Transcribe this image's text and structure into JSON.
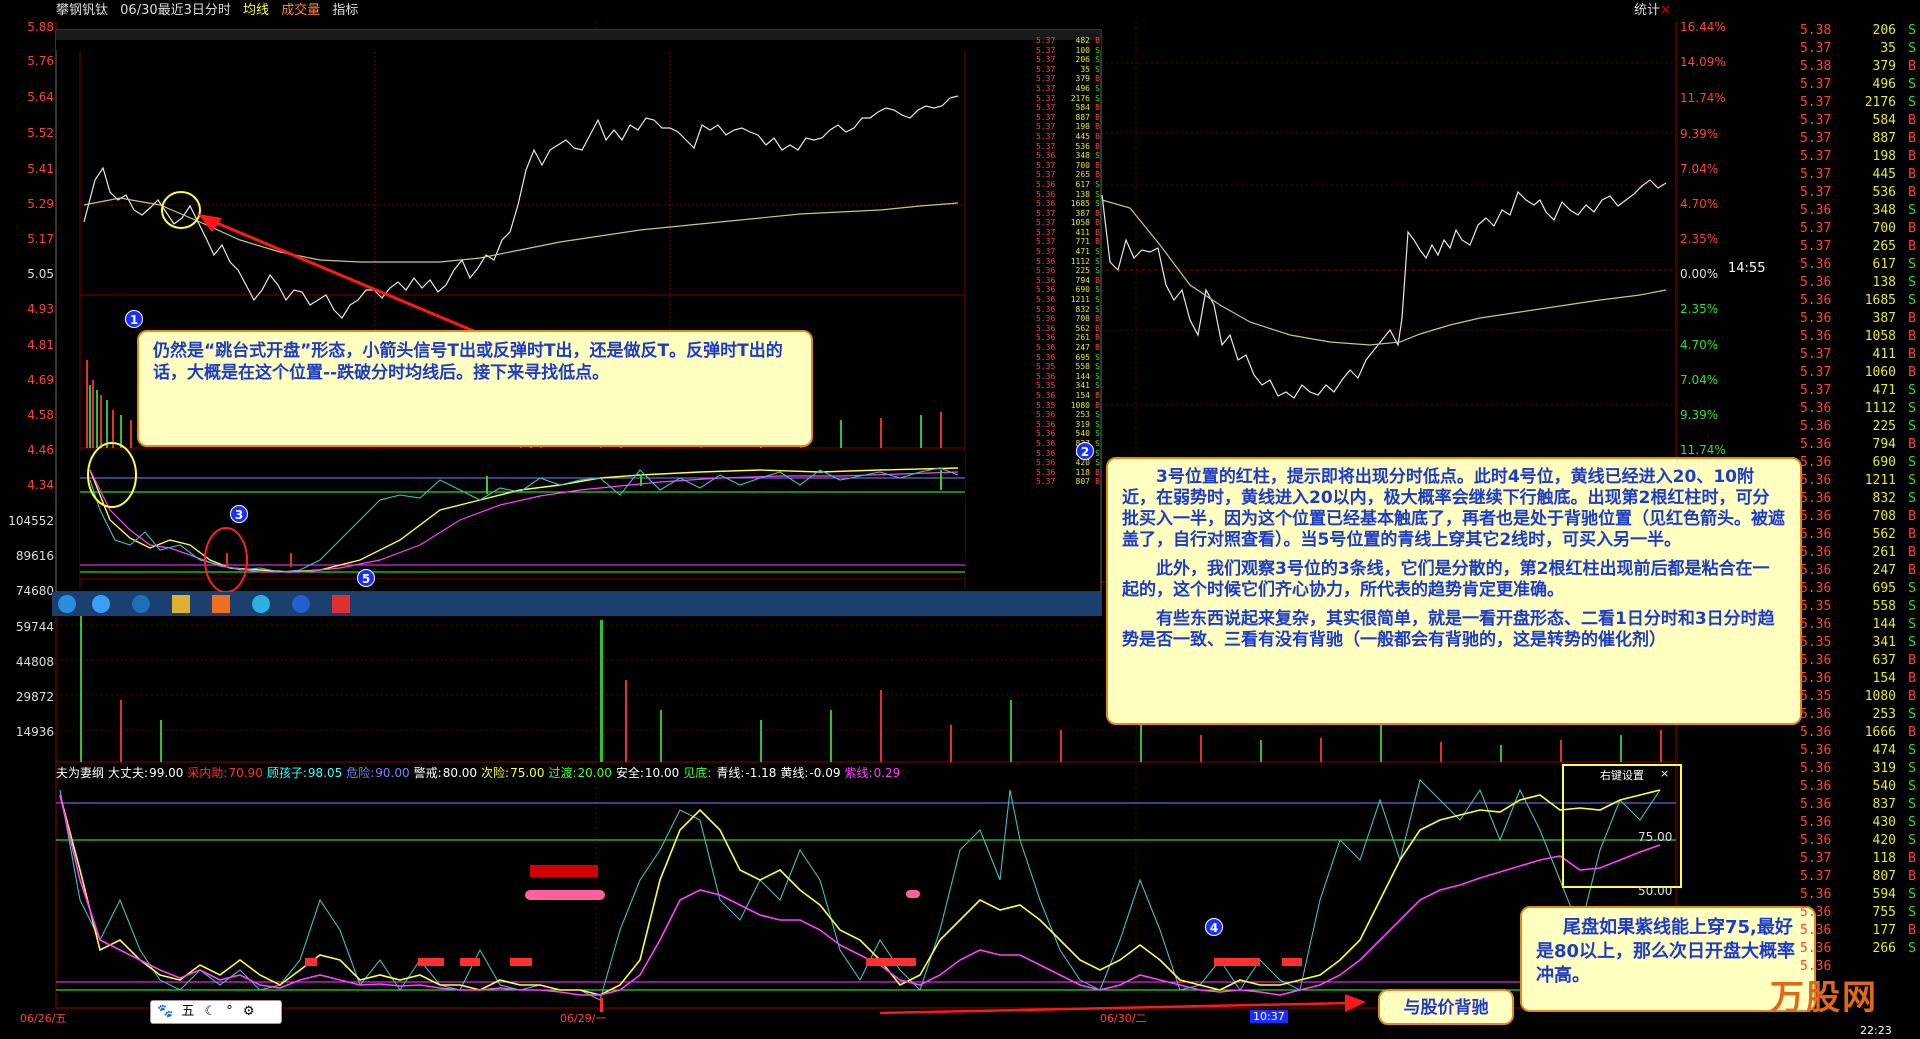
{
  "window": {
    "title_items": [
      "攀钢钒钛",
      "06/30最近3日分时",
      "均线",
      "成交量",
      "指标"
    ],
    "stats_label": "统计"
  },
  "left_axis": {
    "prices": [
      "5.88",
      "5.76",
      "5.64",
      "5.52",
      "5.41",
      "5.29",
      "5.17",
      "5.05",
      "4.93",
      "4.81",
      "4.69",
      "4.58",
      "4.46",
      "4.34"
    ],
    "volumes": [
      "104552",
      "89616",
      "74680",
      "59744",
      "44808",
      "29872",
      "14936"
    ]
  },
  "right_axis_pct_top": [
    "16.44%",
    "14.09%",
    "11.74%",
    "9.39%",
    "7.04%",
    "4.70%",
    "2.35%",
    "0.00%"
  ],
  "right_axis_pct_bottom": [
    "2.35%",
    "4.70%",
    "7.04%",
    "9.39%",
    "11.74%"
  ],
  "right_side_time": "14:55",
  "indicator_header": {
    "name": "夫为妻纲",
    "items": [
      {
        "label": "大丈夫:",
        "value": "99.00",
        "color": "#ffffff"
      },
      {
        "label": "采内助:",
        "value": "70.90",
        "color": "#ff3030"
      },
      {
        "label": "顾孩子:",
        "value": "98.05",
        "color": "#40ffff"
      },
      {
        "label": "危险:",
        "value": "90.00",
        "color": "#8080ff"
      },
      {
        "label": "警戒:",
        "value": "80.00",
        "color": "#ffffff"
      },
      {
        "label": "次险:",
        "value": "75.00",
        "color": "#ffff40"
      },
      {
        "label": "过渡:",
        "value": "20.00",
        "color": "#40ff40"
      },
      {
        "label": "安全:",
        "value": "10.00",
        "color": "#ffffff"
      },
      {
        "label": "见底:",
        "value": "",
        "color": "#40ff40"
      },
      {
        "label": "青线:",
        "value": "-1.18",
        "color": "#ffffff"
      },
      {
        "label": "黄线:",
        "value": "-0.09",
        "color": "#ffffff"
      },
      {
        "label": "紫线:",
        "value": "0.29",
        "color": "#ff40ff"
      }
    ]
  },
  "indicator_levels": {
    "upper": "75.00",
    "lower": "50.00"
  },
  "settings_box_label": "右键设置",
  "dates": {
    "d1": "06/26/五",
    "d2": "06/29/一",
    "d3": "06/30/二",
    "time": "10:37"
  },
  "notes": {
    "note1": "仍然是“跳台式开盘”形态，小箭头信号T出或反弹时T出，还是做反T。反弹时T出的话，大概是在这个位置--跌破分时均线后。接下来寻找低点。",
    "note2_p1": "3号位置的红柱，提示即将出现分时低点。此时4号位，黄线已经进入20、10附近，在弱势时，黄线进入20以内，极大概率会继续下行触底。出现第2根红柱时，可分批买入一半，因为这个位置已经基本触底了，再者也是处于背驰位置（见红色箭头。被遮盖了，自行对照查看）。当5号位置的青线上穿其它2线时，可买入另一半。",
    "note2_p2": "此外，我们观察3号位的3条线，它们是分散的，第2根红柱出现前后都是粘合在一起的，这个时候它们齐心协力，所代表的趋势肯定更准确。",
    "note2_p3": "有些东西说起来复杂，其实很简单，就是一看开盘形态、二看1日分时和3日分时趋势是否一致、三看有没有背驰（一般都会有背驰的，这是转势的催化剂）",
    "note3": "尾盘如果紫线能上穿75,最好是80以上，那么次日开盘大概率冲高。",
    "note4": "与股价背驰"
  },
  "markers": [
    "1",
    "2",
    "3",
    "4",
    "5"
  ],
  "toolbar_glyph": "五",
  "watermark": "万股网",
  "clock": "22:23",
  "ticker": [
    {
      "p": "5.38",
      "v": "206",
      "s": "S"
    },
    {
      "p": "5.37",
      "v": "35",
      "s": "S"
    },
    {
      "p": "5.38",
      "v": "379",
      "s": "B"
    },
    {
      "p": "5.37",
      "v": "496",
      "s": "S"
    },
    {
      "p": "5.37",
      "v": "2176",
      "s": "S"
    },
    {
      "p": "5.37",
      "v": "584",
      "s": "B"
    },
    {
      "p": "5.37",
      "v": "887",
      "s": "B"
    },
    {
      "p": "5.37",
      "v": "198",
      "s": "B"
    },
    {
      "p": "5.37",
      "v": "445",
      "s": "B"
    },
    {
      "p": "5.37",
      "v": "536",
      "s": "B"
    },
    {
      "p": "5.36",
      "v": "348",
      "s": "S"
    },
    {
      "p": "5.37",
      "v": "700",
      "s": "B"
    },
    {
      "p": "5.37",
      "v": "265",
      "s": "B"
    },
    {
      "p": "5.36",
      "v": "617",
      "s": "S"
    },
    {
      "p": "5.36",
      "v": "138",
      "s": "S"
    },
    {
      "p": "5.36",
      "v": "1685",
      "s": "S"
    },
    {
      "p": "5.36",
      "v": "387",
      "s": "B"
    },
    {
      "p": "5.36",
      "v": "1058",
      "s": "B"
    },
    {
      "p": "5.37",
      "v": "411",
      "s": "B"
    },
    {
      "p": "5.37",
      "v": "1060",
      "s": "B"
    },
    {
      "p": "5.37",
      "v": "471",
      "s": "S"
    },
    {
      "p": "5.36",
      "v": "1112",
      "s": "S"
    },
    {
      "p": "5.36",
      "v": "225",
      "s": "S"
    },
    {
      "p": "5.36",
      "v": "794",
      "s": "B"
    },
    {
      "p": "5.36",
      "v": "690",
      "s": "S"
    },
    {
      "p": "5.36",
      "v": "1211",
      "s": "S"
    },
    {
      "p": "5.36",
      "v": "832",
      "s": "S"
    },
    {
      "p": "5.36",
      "v": "708",
      "s": "B"
    },
    {
      "p": "5.36",
      "v": "562",
      "s": "B"
    },
    {
      "p": "5.36",
      "v": "261",
      "s": "B"
    },
    {
      "p": "5.36",
      "v": "247",
      "s": "B"
    },
    {
      "p": "5.36",
      "v": "695",
      "s": "S"
    },
    {
      "p": "5.35",
      "v": "558",
      "s": "S"
    },
    {
      "p": "5.36",
      "v": "144",
      "s": "S"
    },
    {
      "p": "5.35",
      "v": "341",
      "s": "S"
    },
    {
      "p": "5.36",
      "v": "637",
      "s": "B"
    },
    {
      "p": "5.36",
      "v": "154",
      "s": "B"
    },
    {
      "p": "5.35",
      "v": "1080",
      "s": "B"
    },
    {
      "p": "5.36",
      "v": "253",
      "s": "S"
    },
    {
      "p": "5.36",
      "v": "1666",
      "s": "B"
    },
    {
      "p": "5.36",
      "v": "474",
      "s": "S"
    },
    {
      "p": "5.36",
      "v": "319",
      "s": "S"
    },
    {
      "p": "5.36",
      "v": "540",
      "s": "S"
    },
    {
      "p": "5.36",
      "v": "837",
      "s": "S"
    },
    {
      "p": "5.36",
      "v": "430",
      "s": "S"
    },
    {
      "p": "5.36",
      "v": "420",
      "s": "S"
    },
    {
      "p": "5.37",
      "v": "118",
      "s": "B"
    },
    {
      "p": "5.37",
      "v": "807",
      "s": "B"
    },
    {
      "p": "5.36",
      "v": "594",
      "s": "S"
    },
    {
      "p": "5.36",
      "v": "755",
      "s": "S"
    },
    {
      "p": "5.36",
      "v": "177",
      "s": "B"
    },
    {
      "p": "5.36",
      "v": "266",
      "s": "S"
    },
    {
      "p": "5.36",
      "v": "",
      "s": ""
    }
  ],
  "inner_ticker": [
    {
      "p": "5.37",
      "v": "482",
      "s": "B"
    },
    {
      "p": "5.37",
      "v": "100",
      "s": "S"
    },
    {
      "p": "5.37",
      "v": "206",
      "s": "S"
    },
    {
      "p": "5.37",
      "v": "35",
      "s": "S"
    },
    {
      "p": "5.37",
      "v": "379",
      "s": "B"
    },
    {
      "p": "5.37",
      "v": "496",
      "s": "S"
    },
    {
      "p": "5.37",
      "v": "2176",
      "s": "S"
    },
    {
      "p": "5.37",
      "v": "584",
      "s": "B"
    },
    {
      "p": "5.37",
      "v": "887",
      "s": "B"
    },
    {
      "p": "5.37",
      "v": "198",
      "s": "B"
    },
    {
      "p": "5.37",
      "v": "445",
      "s": "B"
    },
    {
      "p": "5.37",
      "v": "536",
      "s": "B"
    },
    {
      "p": "5.36",
      "v": "348",
      "s": "S"
    },
    {
      "p": "5.37",
      "v": "700",
      "s": "B"
    },
    {
      "p": "5.37",
      "v": "265",
      "s": "B"
    },
    {
      "p": "5.36",
      "v": "617",
      "s": "S"
    },
    {
      "p": "5.36",
      "v": "138",
      "s": "S"
    },
    {
      "p": "5.36",
      "v": "1685",
      "s": "S"
    },
    {
      "p": "5.37",
      "v": "387",
      "s": "B"
    },
    {
      "p": "5.37",
      "v": "1058",
      "s": "B"
    },
    {
      "p": "5.37",
      "v": "411",
      "s": "B"
    },
    {
      "p": "5.37",
      "v": "771",
      "s": "B"
    },
    {
      "p": "5.37",
      "v": "471",
      "s": "S"
    },
    {
      "p": "5.36",
      "v": "1112",
      "s": "S"
    },
    {
      "p": "5.36",
      "v": "225",
      "s": "S"
    },
    {
      "p": "5.36",
      "v": "794",
      "s": "B"
    },
    {
      "p": "5.36",
      "v": "690",
      "s": "S"
    },
    {
      "p": "5.36",
      "v": "1211",
      "s": "S"
    },
    {
      "p": "5.36",
      "v": "832",
      "s": "S"
    },
    {
      "p": "5.36",
      "v": "708",
      "s": "B"
    },
    {
      "p": "5.36",
      "v": "562",
      "s": "B"
    },
    {
      "p": "5.36",
      "v": "261",
      "s": "B"
    },
    {
      "p": "5.36",
      "v": "247",
      "s": "B"
    },
    {
      "p": "5.36",
      "v": "695",
      "s": "S"
    },
    {
      "p": "5.35",
      "v": "558",
      "s": "S"
    },
    {
      "p": "5.36",
      "v": "144",
      "s": "S"
    },
    {
      "p": "5.35",
      "v": "341",
      "s": "S"
    },
    {
      "p": "5.36",
      "v": "154",
      "s": "B"
    },
    {
      "p": "5.35",
      "v": "1080",
      "s": "B"
    },
    {
      "p": "5.36",
      "v": "253",
      "s": "S"
    },
    {
      "p": "5.36",
      "v": "319",
      "s": "S"
    },
    {
      "p": "5.36",
      "v": "540",
      "s": "S"
    },
    {
      "p": "5.36",
      "v": "837",
      "s": "S"
    },
    {
      "p": "5.36",
      "v": "430",
      "s": "S"
    },
    {
      "p": "5.36",
      "v": "420",
      "s": "S"
    },
    {
      "p": "5.36",
      "v": "118",
      "s": "B"
    },
    {
      "p": "5.37",
      "v": "807",
      "s": "B"
    }
  ]
}
